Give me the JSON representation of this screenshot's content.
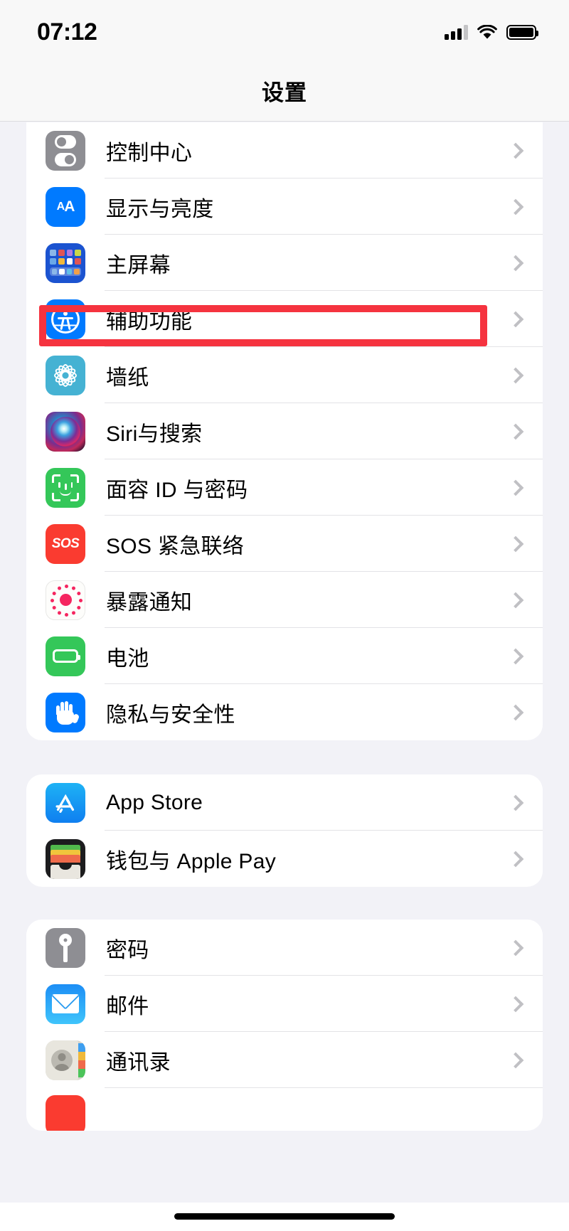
{
  "status_bar": {
    "time": "07:12",
    "cellular_icon": "signal-bars-icon",
    "wifi_icon": "wifi-icon",
    "battery_icon": "battery-full-icon"
  },
  "header": {
    "title": "设置"
  },
  "highlight": {
    "target_row": "辅助功能",
    "color": "#f5333f",
    "note": "红色高亮框"
  },
  "theme": {
    "background": "#f2f2f7",
    "card": "#ffffff",
    "separator": "#e3e3e6",
    "chevron": "#c0c0c4",
    "text": "#000000"
  },
  "groups": [
    {
      "id": "system-group",
      "clipped_top": true,
      "rows": [
        {
          "label": "控制中心",
          "icon": "control-center-icon",
          "color": "#8e8e93",
          "chevron": "chevron-right-icon"
        },
        {
          "label": "显示与亮度",
          "icon": "display-brightness-icon",
          "color": "#007aff",
          "chevron": "chevron-right-icon"
        },
        {
          "label": "主屏幕",
          "icon": "home-screen-icon",
          "color": "#1b53d0",
          "chevron": "chevron-right-icon"
        },
        {
          "label": "辅助功能",
          "icon": "accessibility-icon",
          "color": "#007aff",
          "chevron": "chevron-right-icon",
          "highlighted": true
        },
        {
          "label": "墙纸",
          "icon": "wallpaper-icon",
          "color": "#45b2d3",
          "chevron": "chevron-right-icon"
        },
        {
          "label": "Siri与搜索",
          "icon": "siri-icon",
          "color": "#2a1230",
          "chevron": "chevron-right-icon"
        },
        {
          "label": "面容 ID 与密码",
          "icon": "face-id-icon",
          "color": "#34c759",
          "chevron": "chevron-right-icon"
        },
        {
          "label": "SOS 紧急联络",
          "icon": "emergency-sos-icon",
          "color": "#fa3b30",
          "chevron": "chevron-right-icon",
          "icon_text": "SOS"
        },
        {
          "label": "暴露通知",
          "icon": "exposure-notification-icon",
          "color": "#f5255f",
          "chevron": "chevron-right-icon"
        },
        {
          "label": "电池",
          "icon": "battery-icon",
          "color": "#34c759",
          "chevron": "chevron-right-icon"
        },
        {
          "label": "隐私与安全性",
          "icon": "privacy-security-icon",
          "color": "#007aff",
          "chevron": "chevron-right-icon"
        }
      ]
    },
    {
      "id": "store-group",
      "clipped_top": false,
      "rows": [
        {
          "label": "App Store",
          "icon": "app-store-icon",
          "color": "#0f7ff0",
          "chevron": "chevron-right-icon"
        },
        {
          "label": "钱包与 Apple Pay",
          "icon": "wallet-icon",
          "color": "#1c1c1e",
          "chevron": "chevron-right-icon"
        }
      ]
    },
    {
      "id": "apps-group",
      "clipped_top": false,
      "rows": [
        {
          "label": "密码",
          "icon": "passwords-key-icon",
          "color": "#8e8e93",
          "chevron": "chevron-right-icon"
        },
        {
          "label": "邮件",
          "icon": "mail-icon",
          "color": "#1d8ef5",
          "chevron": "chevron-right-icon"
        },
        {
          "label": "通讯录",
          "icon": "contacts-icon",
          "color": "#d7d5cd",
          "chevron": "chevron-right-icon"
        },
        {
          "label": "",
          "icon": "calendar-icon",
          "color": "#fa3b30",
          "chevron": "",
          "partial": true
        }
      ]
    }
  ],
  "home_indicator": "home-indicator-bar"
}
